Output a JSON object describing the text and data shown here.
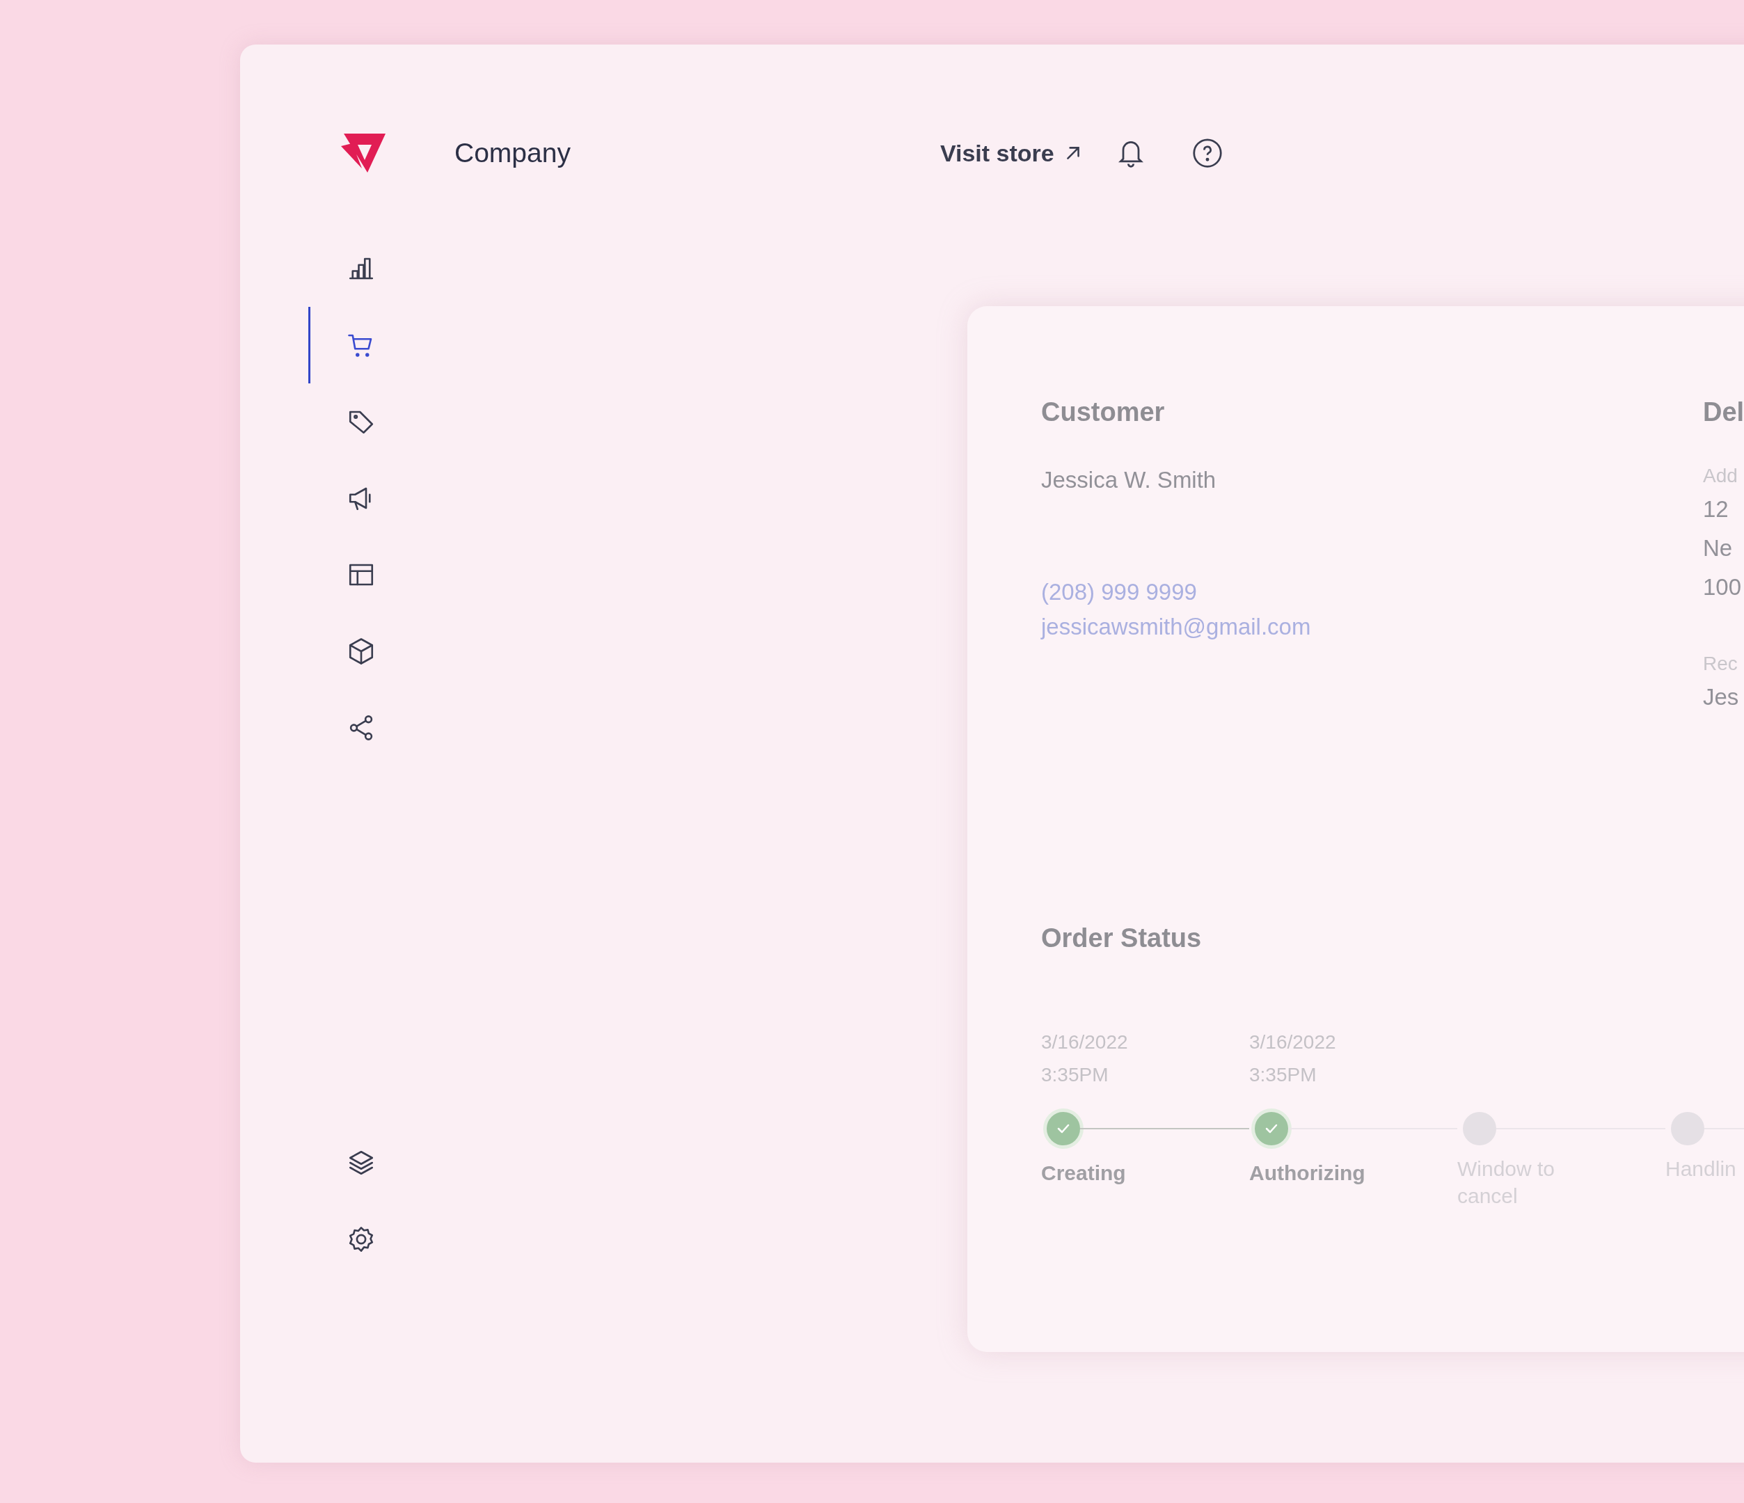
{
  "header": {
    "brand": "Company",
    "visit_store": "Visit store"
  },
  "sidebar": {
    "items": [
      {
        "selected": false
      },
      {
        "selected": true
      },
      {
        "selected": false
      },
      {
        "selected": false
      },
      {
        "selected": false
      },
      {
        "selected": false
      },
      {
        "selected": false
      }
    ],
    "bottom_items": [
      {
        "selected": false
      },
      {
        "selected": false
      }
    ]
  },
  "customer": {
    "heading": "Customer",
    "name": "Jessica W. Smith",
    "phone": "(208) 999 9999",
    "email": "jessicawsmith@gmail.com"
  },
  "delivery": {
    "heading": "Del",
    "address_label": "Add",
    "address_lines": [
      "12",
      "Ne",
      "100"
    ],
    "recipient_label": "Rec",
    "recipient": "Jes"
  },
  "order_status": {
    "heading": "Order Status",
    "steps": [
      {
        "label": "Creating",
        "date": "3/16/2022",
        "time": "3:35PM",
        "done": true
      },
      {
        "label": "Authorizing",
        "date": "3/16/2022",
        "time": "3:35PM",
        "done": true
      },
      {
        "label": "Window to cancel",
        "done": false
      },
      {
        "label": "Handlin",
        "done": false
      }
    ]
  }
}
